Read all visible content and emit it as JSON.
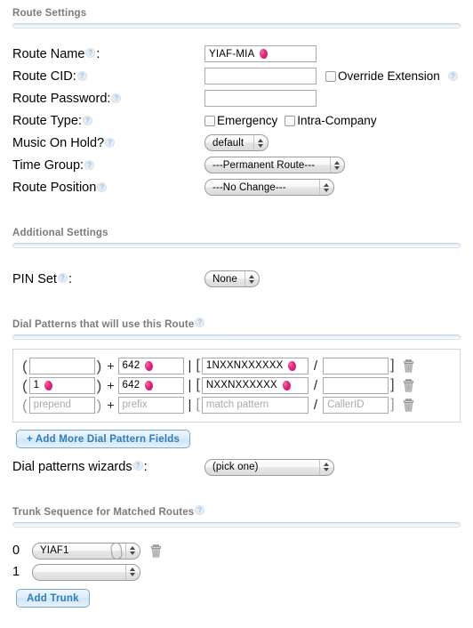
{
  "sections": {
    "route_settings": "Route Settings",
    "additional_settings": "Additional Settings",
    "dial_patterns": "Dial Patterns that will use this Route",
    "trunk_sequence": "Trunk Sequence for Matched Routes"
  },
  "icons": {
    "help": "?",
    "trash": "trash-icon"
  },
  "route_settings": {
    "route_name": {
      "label": "Route Name",
      "colon": ":",
      "value": "YIAF-MIA",
      "placeholder": ""
    },
    "route_cid": {
      "label": "Route CID:",
      "value": "",
      "placeholder": "",
      "override_label": "Override Extension",
      "override_checked": false
    },
    "route_password": {
      "label": "Route Password:",
      "value": "",
      "placeholder": ""
    },
    "route_type": {
      "label": "Route Type:",
      "emergency_label": "Emergency",
      "emergency_checked": false,
      "intra_label": "Intra-Company",
      "intra_checked": false
    },
    "music_on_hold": {
      "label": "Music On Hold?",
      "value": "default"
    },
    "time_group": {
      "label": "Time Group:",
      "value": "---Permanent Route---"
    },
    "route_position": {
      "label": "Route Position",
      "value": "---No Change---"
    }
  },
  "additional_settings": {
    "pin_set": {
      "label": "PIN Set",
      "colon": ":",
      "value": "None"
    }
  },
  "dial_patterns": {
    "columns": {
      "prepend": "prepend",
      "prefix": "prefix",
      "match": "match pattern",
      "callerid": "CallerID"
    },
    "symbols": {
      "open_paren": "(",
      "close_paren": ")",
      "plus": "+",
      "pipe": "|",
      "open_bracket": "[",
      "close_bracket": "]",
      "slash": "/"
    },
    "rows": [
      {
        "prepend": "",
        "prepend_blob": false,
        "prefix": "642",
        "prefix_blob": true,
        "match": "1NXXNXXXXXX",
        "match_blob": true,
        "callerid": "",
        "callerid_blob": false
      },
      {
        "prepend": "1",
        "prepend_blob": true,
        "prefix": "642",
        "prefix_blob": true,
        "match": "NXXNXXXXXX",
        "match_blob": true,
        "callerid": "",
        "callerid_blob": false
      },
      {
        "prepend": "",
        "prepend_blob": false,
        "prefix": "",
        "prefix_blob": false,
        "match": "",
        "match_blob": false,
        "callerid": "",
        "callerid_blob": false
      }
    ],
    "add_button": "+ Add More Dial Pattern Fields",
    "wizards": {
      "label": "Dial patterns wizards",
      "colon": ":",
      "value": "(pick one)"
    }
  },
  "trunk_sequence": {
    "rows": [
      {
        "index": "0",
        "value": "YIAF1",
        "blob": true,
        "has_trash": true
      },
      {
        "index": "1",
        "value": "",
        "blob": false,
        "has_trash": false
      }
    ],
    "add_button": "Add Trunk"
  },
  "colors": {
    "accent_blue": "#2f7dba",
    "rule_blue": "#dbe8f4",
    "heading_gray": "#7b7b7b",
    "blob_pink": "#e0217a",
    "border_gray": "#a9a9a9"
  }
}
